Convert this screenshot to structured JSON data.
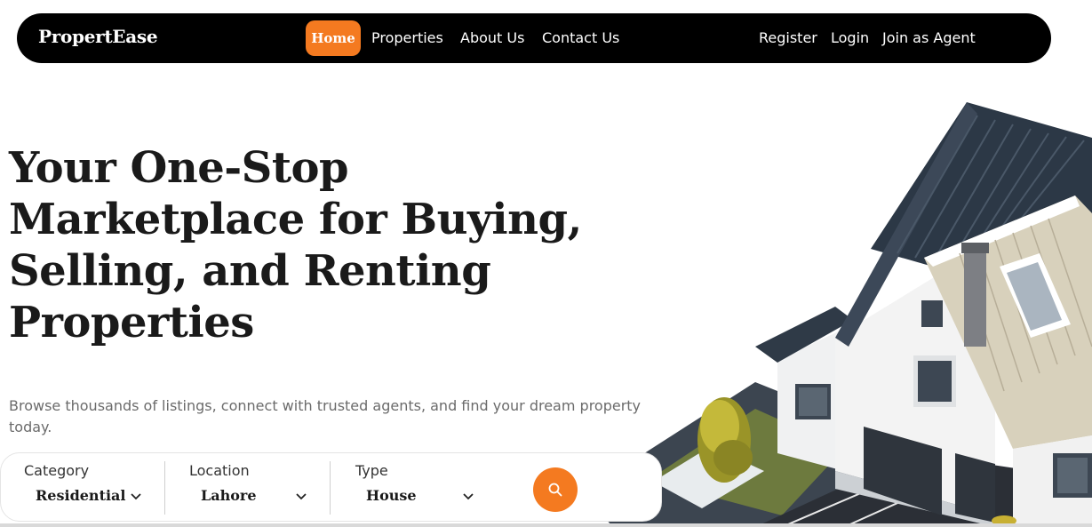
{
  "nav": {
    "brand": "PropertEase",
    "home": "Home",
    "properties": "Properties",
    "about": "About Us",
    "contact": "Contact Us",
    "register": "Register",
    "login": "Login",
    "agent": "Join as Agent"
  },
  "hero": {
    "title": "Your One-Stop Marketplace for Buying, Selling, and Renting Properties",
    "subtitle": "Browse thousands of listings, connect with trusted agents, and find your dream property today."
  },
  "search": {
    "category_label": "Category",
    "category_value": "Residential",
    "location_label": "Location",
    "location_value": "Lahore",
    "type_label": "Type",
    "type_value": "House",
    "icon": "search-icon"
  },
  "colors": {
    "accent": "#f47a20",
    "nav_bg": "#000000"
  }
}
